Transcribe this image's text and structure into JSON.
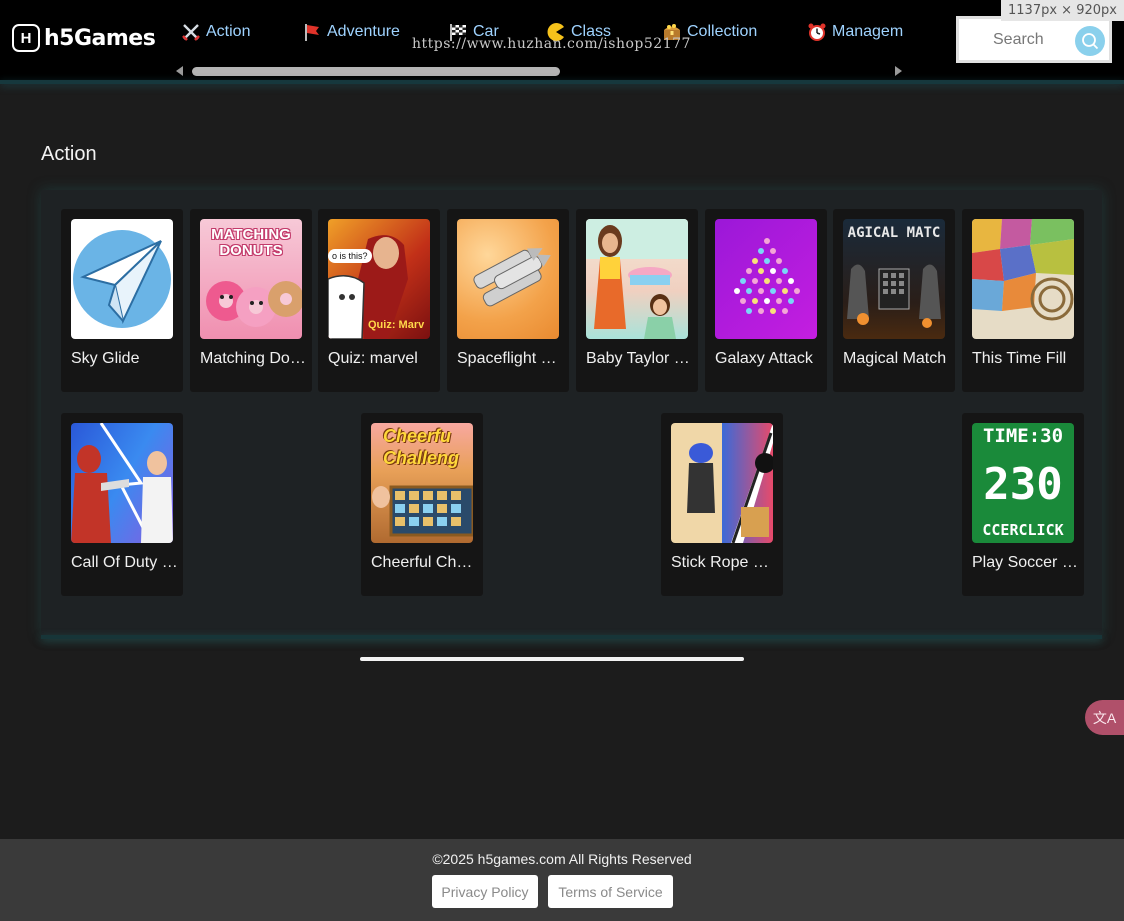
{
  "header": {
    "logo_text": "h5Games",
    "logo_mark": "H",
    "nav": [
      {
        "label": "Action",
        "icon": "crossed-swords-icon"
      },
      {
        "label": "Adventure",
        "icon": "red-flag-icon"
      },
      {
        "label": "Car",
        "icon": "checkered-flag-icon"
      },
      {
        "label": "Class",
        "icon": "pacman-icon"
      },
      {
        "label": "Collection",
        "icon": "treasure-chest-icon"
      },
      {
        "label": "Managem",
        "icon": "alarm-clock-icon"
      }
    ],
    "search_placeholder": "Search",
    "url_overlay": "https://www.huzhan.com/ishop52177",
    "dimension_overlay": "1137px × 920px"
  },
  "section": {
    "title": "Action",
    "games": [
      {
        "title": "Sky Glide"
      },
      {
        "title": "Matching Donuts",
        "thumb_text": "MATCHING DONUTS"
      },
      {
        "title": "Quiz: marvel",
        "thumb_text": "Quiz: Marv",
        "bubble_text": "o is this?"
      },
      {
        "title": "Spaceflight Simulator"
      },
      {
        "title": "Baby Taylor Cake"
      },
      {
        "title": "Galaxy Attack"
      },
      {
        "title": "Magical Match",
        "thumb_text": "AGICAL MATC"
      },
      {
        "title": "This Time Fill"
      },
      {
        "title": "Call Of Duty Hero"
      },
      {
        "title": "Cheerful Challenge",
        "thumb_text": "Cheerfu Challeng"
      },
      {
        "title": "Stick Rope Hero"
      },
      {
        "title": "Play Soccer Click",
        "thumb_line1": "TIME:30",
        "thumb_line2": "230",
        "thumb_line3": "CCERCLICK"
      }
    ]
  },
  "translate_fab_text": "文A",
  "footer": {
    "copyright": "©2025 h5games.com All Rights Reserved",
    "privacy_label": "Privacy Policy",
    "terms_label": "Terms of Service"
  }
}
